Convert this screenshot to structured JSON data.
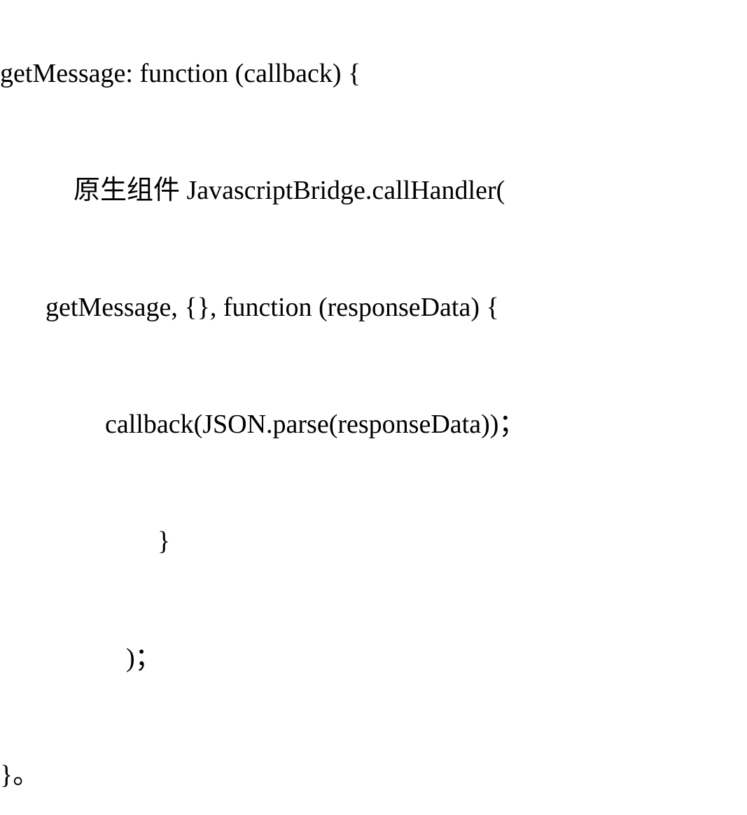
{
  "code": {
    "line1": "getMessage: function (callback) {",
    "line2": "原生组件 JavascriptBridge.callHandler(",
    "line3": "getMessage, {}, function (responseData) {",
    "line4": "callback(JSON.parse(responseData))；",
    "line5": "}",
    "line6": ")；",
    "line7": "}。"
  }
}
